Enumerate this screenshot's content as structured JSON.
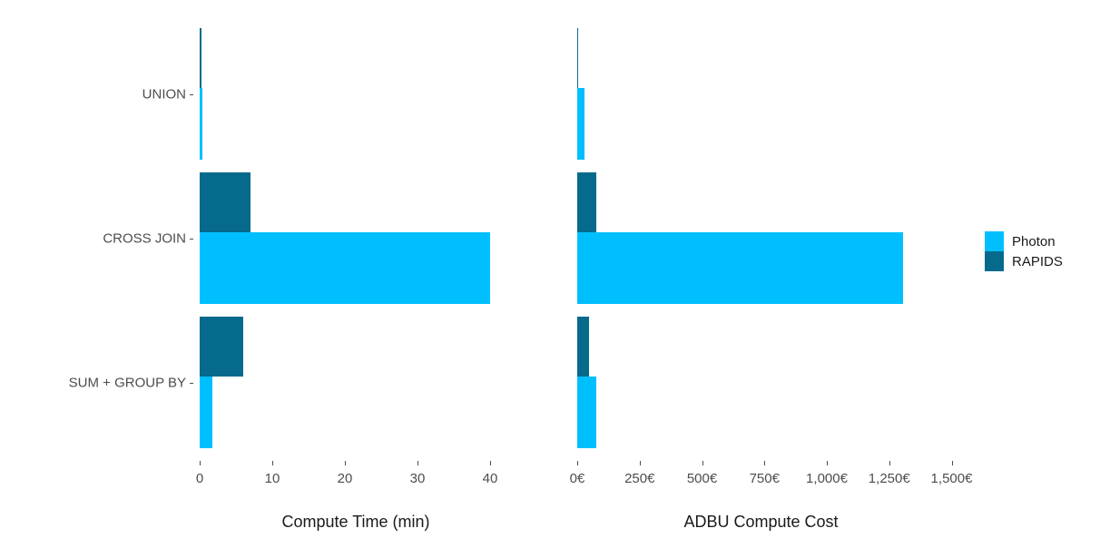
{
  "chart_data": {
    "type": "bar",
    "orientation": "horizontal",
    "title": "",
    "categories": [
      "UNION",
      "CROSS JOIN",
      "SUM + GROUP BY"
    ],
    "series": [
      {
        "name": "Photon",
        "color": "#00bfff"
      },
      {
        "name": "RAPIDS",
        "color": "#056a8c"
      }
    ],
    "panels": [
      {
        "xlabel": "Compute Time (min)",
        "xlim": [
          0,
          43
        ],
        "ticks": [
          0,
          10,
          20,
          30,
          40
        ],
        "tick_labels": [
          "0",
          "10",
          "20",
          "30",
          "40"
        ],
        "values": {
          "Photon": [
            0.35,
            40.0,
            1.75
          ],
          "RAPIDS": [
            0.2,
            7.0,
            6.0
          ]
        }
      },
      {
        "xlabel": "ADBU Compute Cost",
        "xlim": [
          0,
          1560
        ],
        "ticks": [
          0,
          250,
          500,
          750,
          1000,
          1250,
          1500
        ],
        "tick_labels": [
          "0€",
          "250€",
          "500€",
          "750€",
          "1,000€",
          "1,250€",
          "1,500€"
        ],
        "values": {
          "Photon": [
            29,
            1305,
            77
          ],
          "RAPIDS": [
            4,
            75,
            48
          ]
        }
      }
    ],
    "legend": {
      "position": "right",
      "entries": [
        "Photon",
        "RAPIDS"
      ]
    },
    "grid": false
  }
}
